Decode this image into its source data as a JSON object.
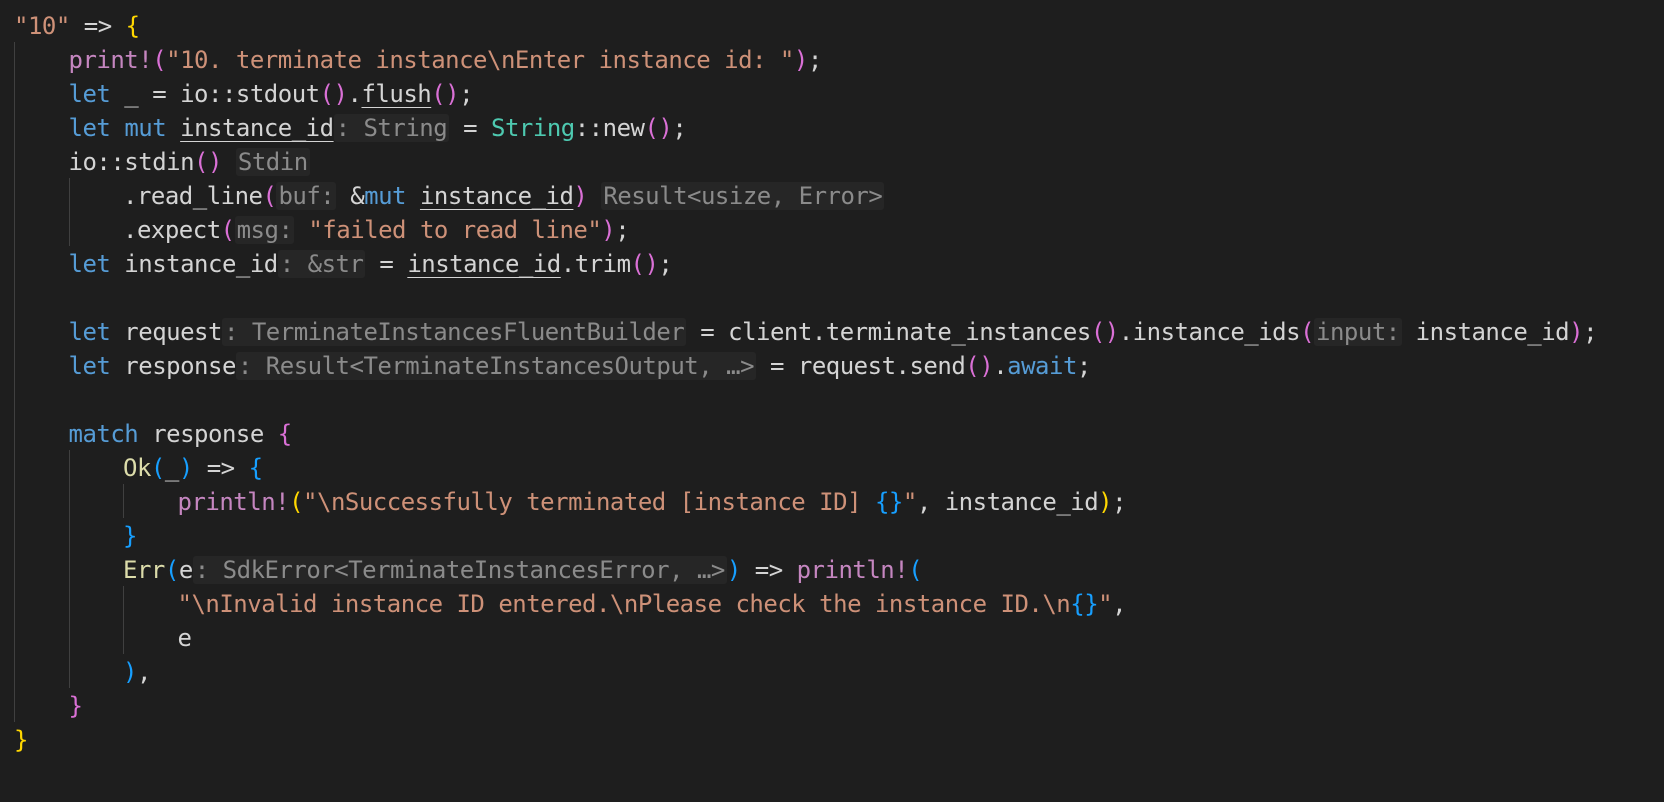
{
  "editor": {
    "language": "rust",
    "lines": [
      {
        "indent": 0,
        "tokens": [
          [
            "str",
            "\"10\""
          ],
          [
            "var",
            " => "
          ],
          [
            "b1",
            "{"
          ]
        ]
      },
      {
        "indent": 1,
        "tokens": [
          [
            "mac",
            "print!"
          ],
          [
            "b2",
            "("
          ],
          [
            "str",
            "\"10. terminate instance\\nEnter instance id: \""
          ],
          [
            "b2",
            ")"
          ],
          [
            "var",
            ";"
          ]
        ]
      },
      {
        "indent": 1,
        "tokens": [
          [
            "kw",
            "let"
          ],
          [
            "var",
            " _ = io::stdout"
          ],
          [
            "b2",
            "()"
          ],
          [
            "var",
            "."
          ],
          [
            "ul",
            "flush"
          ],
          [
            "b2",
            "()"
          ],
          [
            "var",
            ";"
          ]
        ]
      },
      {
        "indent": 1,
        "tokens": [
          [
            "kw",
            "let"
          ],
          [
            "var",
            " "
          ],
          [
            "kw",
            "mut"
          ],
          [
            "var",
            " "
          ],
          [
            "ul",
            "instance_id"
          ],
          [
            "hint",
            ": String"
          ],
          [
            "var",
            " = "
          ],
          [
            "ty",
            "String"
          ],
          [
            "var",
            "::new"
          ],
          [
            "b2",
            "()"
          ],
          [
            "var",
            ";"
          ]
        ]
      },
      {
        "indent": 1,
        "tokens": [
          [
            "var",
            "io::stdin"
          ],
          [
            "b2",
            "()"
          ],
          [
            "var",
            " "
          ],
          [
            "hint",
            "Stdin"
          ]
        ]
      },
      {
        "indent": 2,
        "tokens": [
          [
            "var",
            ".read_line"
          ],
          [
            "b2",
            "("
          ],
          [
            "hint",
            "buf:"
          ],
          [
            "var",
            " &"
          ],
          [
            "kw",
            "mut"
          ],
          [
            "var",
            " "
          ],
          [
            "ul",
            "instance_id"
          ],
          [
            "b2",
            ")"
          ],
          [
            "var",
            " "
          ],
          [
            "hint",
            "Result<usize, Error>"
          ]
        ]
      },
      {
        "indent": 2,
        "tokens": [
          [
            "var",
            ".expect"
          ],
          [
            "b2",
            "("
          ],
          [
            "hint",
            "msg:"
          ],
          [
            "var",
            " "
          ],
          [
            "str",
            "\"failed to read line\""
          ],
          [
            "b2",
            ")"
          ],
          [
            "var",
            ";"
          ]
        ]
      },
      {
        "indent": 1,
        "tokens": [
          [
            "kw",
            "let"
          ],
          [
            "var",
            " instance_id"
          ],
          [
            "hint",
            ": &str"
          ],
          [
            "var",
            " = "
          ],
          [
            "ul",
            "instance_id"
          ],
          [
            "var",
            ".trim"
          ],
          [
            "b2",
            "()"
          ],
          [
            "var",
            ";"
          ]
        ]
      },
      {
        "indent": 0,
        "tokens": []
      },
      {
        "indent": 1,
        "tokens": [
          [
            "kw",
            "let"
          ],
          [
            "var",
            " request"
          ],
          [
            "hint",
            ": TerminateInstancesFluentBuilder"
          ],
          [
            "var",
            " = client.terminate_instances"
          ],
          [
            "b2",
            "()"
          ],
          [
            "var",
            ".instance_ids"
          ],
          [
            "b2",
            "("
          ],
          [
            "hint",
            "input:"
          ],
          [
            "var",
            " instance_id"
          ],
          [
            "b2",
            ")"
          ],
          [
            "var",
            ";"
          ]
        ]
      },
      {
        "indent": 1,
        "tokens": [
          [
            "kw",
            "let"
          ],
          [
            "var",
            " response"
          ],
          [
            "hint",
            ": Result<TerminateInstancesOutput, …>"
          ],
          [
            "var",
            " = request.send"
          ],
          [
            "b2",
            "()"
          ],
          [
            "var",
            "."
          ],
          [
            "kw",
            "await"
          ],
          [
            "var",
            ";"
          ]
        ]
      },
      {
        "indent": 0,
        "tokens": []
      },
      {
        "indent": 1,
        "tokens": [
          [
            "kw",
            "match"
          ],
          [
            "var",
            " response "
          ],
          [
            "b2",
            "{"
          ]
        ]
      },
      {
        "indent": 2,
        "tokens": [
          [
            "fn",
            "Ok"
          ],
          [
            "b3",
            "("
          ],
          [
            "var",
            "_"
          ],
          [
            "b3",
            ")"
          ],
          [
            "var",
            " => "
          ],
          [
            "b3",
            "{"
          ]
        ]
      },
      {
        "indent": 3,
        "tokens": [
          [
            "mac",
            "println!"
          ],
          [
            "b1",
            "("
          ],
          [
            "str",
            "\"\\nSuccessfully terminated [instance ID] "
          ],
          [
            "b3",
            "{}"
          ],
          [
            "str",
            "\""
          ],
          [
            "var",
            ", instance_id"
          ],
          [
            "b1",
            ")"
          ],
          [
            "var",
            ";"
          ]
        ]
      },
      {
        "indent": 2,
        "tokens": [
          [
            "b3",
            "}"
          ]
        ]
      },
      {
        "indent": 2,
        "tokens": [
          [
            "fn",
            "Err"
          ],
          [
            "b3",
            "("
          ],
          [
            "var",
            "e"
          ],
          [
            "hint",
            ": SdkError<TerminateInstancesError, …>"
          ],
          [
            "b3",
            ")"
          ],
          [
            "var",
            " => "
          ],
          [
            "mac",
            "println!"
          ],
          [
            "b3",
            "("
          ]
        ]
      },
      {
        "indent": 3,
        "tokens": [
          [
            "str",
            "\"\\nInvalid instance ID entered.\\nPlease check the instance ID.\\n"
          ],
          [
            "b3",
            "{}"
          ],
          [
            "str",
            "\""
          ],
          [
            "var",
            ","
          ]
        ]
      },
      {
        "indent": 3,
        "tokens": [
          [
            "var",
            "e"
          ]
        ]
      },
      {
        "indent": 2,
        "tokens": [
          [
            "b3",
            ")"
          ],
          [
            "var",
            ","
          ]
        ]
      },
      {
        "indent": 1,
        "tokens": [
          [
            "b2",
            "}"
          ]
        ]
      },
      {
        "indent": 0,
        "tokens": [
          [
            "b1",
            "}"
          ]
        ]
      }
    ]
  }
}
